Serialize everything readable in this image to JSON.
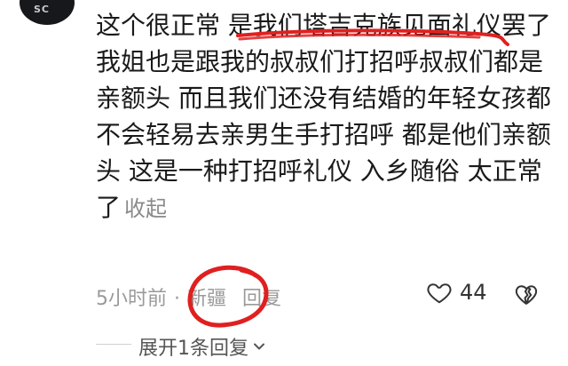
{
  "comment": {
    "text": "这个很正常 是我们塔吉克族见面礼仪罢了我姐也是跟我的叔叔们打招呼叔叔们都是亲额头 而且我们还没有结婚的年轻女孩都不会轻易去亲男生手打招呼 都是他们亲额头 这是一种打招呼礼仪 入乡随俗 太正常了",
    "collapse_label": "收起"
  },
  "meta": {
    "time": "5小时前",
    "separator": "·",
    "region": "新疆",
    "reply_label": "回复"
  },
  "likes": {
    "count": "44"
  },
  "replies": {
    "expand_label": "展开1条回复"
  },
  "avatar": {
    "text": "SC"
  },
  "colors": {
    "annotation_red": "#e02020"
  }
}
